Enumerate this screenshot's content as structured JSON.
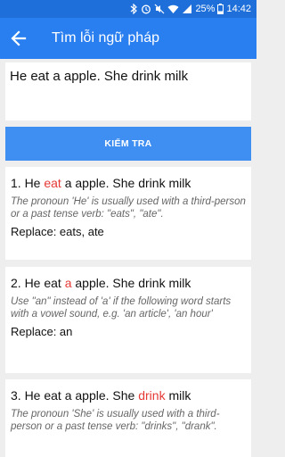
{
  "status": {
    "battery": "25%",
    "time": "14:42"
  },
  "appbar": {
    "title": "Tìm lỗi ngữ pháp"
  },
  "input": {
    "value": "He eat a apple. She drink milk"
  },
  "check_button": {
    "label": "KIỂM TRA"
  },
  "results": [
    {
      "prefix": "1. He ",
      "error": "eat",
      "suffix": " a apple. She drink milk",
      "explanation": "The pronoun 'He' is usually used with a third-person or a past tense verb: \"eats\", \"ate\".",
      "replace": "Replace: eats, ate"
    },
    {
      "prefix": "2. He eat ",
      "error": "a",
      "suffix": " apple. She drink milk",
      "explanation": "Use \"an\" instead of 'a' if the following word starts with a vowel sound, e.g. 'an article', 'an hour'",
      "replace": "Replace: an"
    },
    {
      "prefix": "3. He eat a apple. She ",
      "error": "drink",
      "suffix": " milk",
      "explanation": "The pronoun 'She' is usually used with a third-person or a past tense verb: \"drinks\", \"drank\".",
      "replace": ""
    }
  ],
  "colors": {
    "primary": "#2a7ff0",
    "status_bar": "#1e6fd9",
    "button": "#3f8ff2",
    "error": "#e53935"
  }
}
